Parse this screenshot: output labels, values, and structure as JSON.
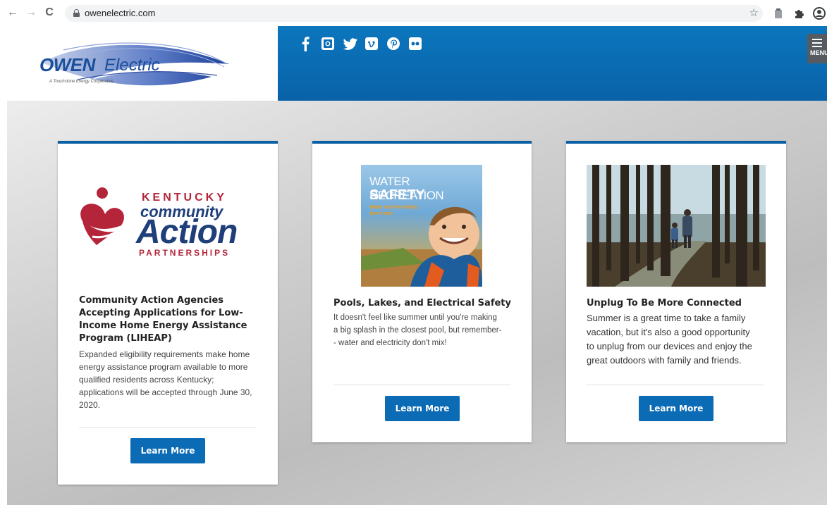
{
  "browser": {
    "url": "owenelectric.com",
    "nav": {
      "back": "←",
      "forward": "→",
      "reload": "C"
    },
    "icons": [
      "star-icon",
      "clipboard-icon",
      "puzzle-icon",
      "profile-icon"
    ]
  },
  "header": {
    "logo": {
      "brand": "OWEN",
      "suffix": "Electric",
      "tagline": "A Touchstone Energy Cooperative"
    },
    "social": [
      {
        "name": "facebook-icon",
        "glyph": "f"
      },
      {
        "name": "instagram-icon",
        "glyph": "◙"
      },
      {
        "name": "twitter-icon",
        "glyph": "🐦"
      },
      {
        "name": "vimeo-icon",
        "glyph": "v"
      },
      {
        "name": "pinterest-icon",
        "glyph": "℗"
      },
      {
        "name": "flickr-icon",
        "glyph": "••"
      }
    ],
    "menu_label": "MENU",
    "colors": {
      "band": "#0b6db5",
      "accent": "#0b5fa5",
      "button": "#0b6bb5"
    }
  },
  "cards": [
    {
      "image_text": {
        "line1": "KENTUCKY",
        "line2": "community",
        "line3": "Action",
        "line4": "PARTNERSHIPS"
      },
      "title": "Community Action Agencies Accepting Applications for Low-Income Home Energy Assistance Program (LIHEAP)",
      "title_lines": [
        "Community Action Agencies",
        "Accepting Applications for Low-",
        "Income Home Energy Assistance",
        "Program (LIHEAP)"
      ],
      "text_lines": [
        "Expanded eligibility requirements make home",
        "energy assistance program available to more",
        "qualified residents across Kentucky;",
        "applications will be accepted through June 30,",
        "2020."
      ],
      "button": "Learn More"
    },
    {
      "image_text": {
        "line1": "WATER RECREATION",
        "line2": "SAFETY",
        "line3": "Water and electricity don't mix!"
      },
      "title": "Pools, Lakes, and Electrical Safety",
      "text_lines": [
        "It doesn't feel like summer until you're making",
        "a big splash in the closest pool, but remember-",
        "- water and electricity don't mix!"
      ],
      "button": "Learn More"
    },
    {
      "title": "Unplug To Be More Connected",
      "text_lines": [
        "Summer is a great time to take a family",
        "vacation, but it's also a good opportunity",
        "to unplug from our devices and enjoy the",
        "great outdoors with family and friends."
      ],
      "button": "Learn More"
    }
  ]
}
